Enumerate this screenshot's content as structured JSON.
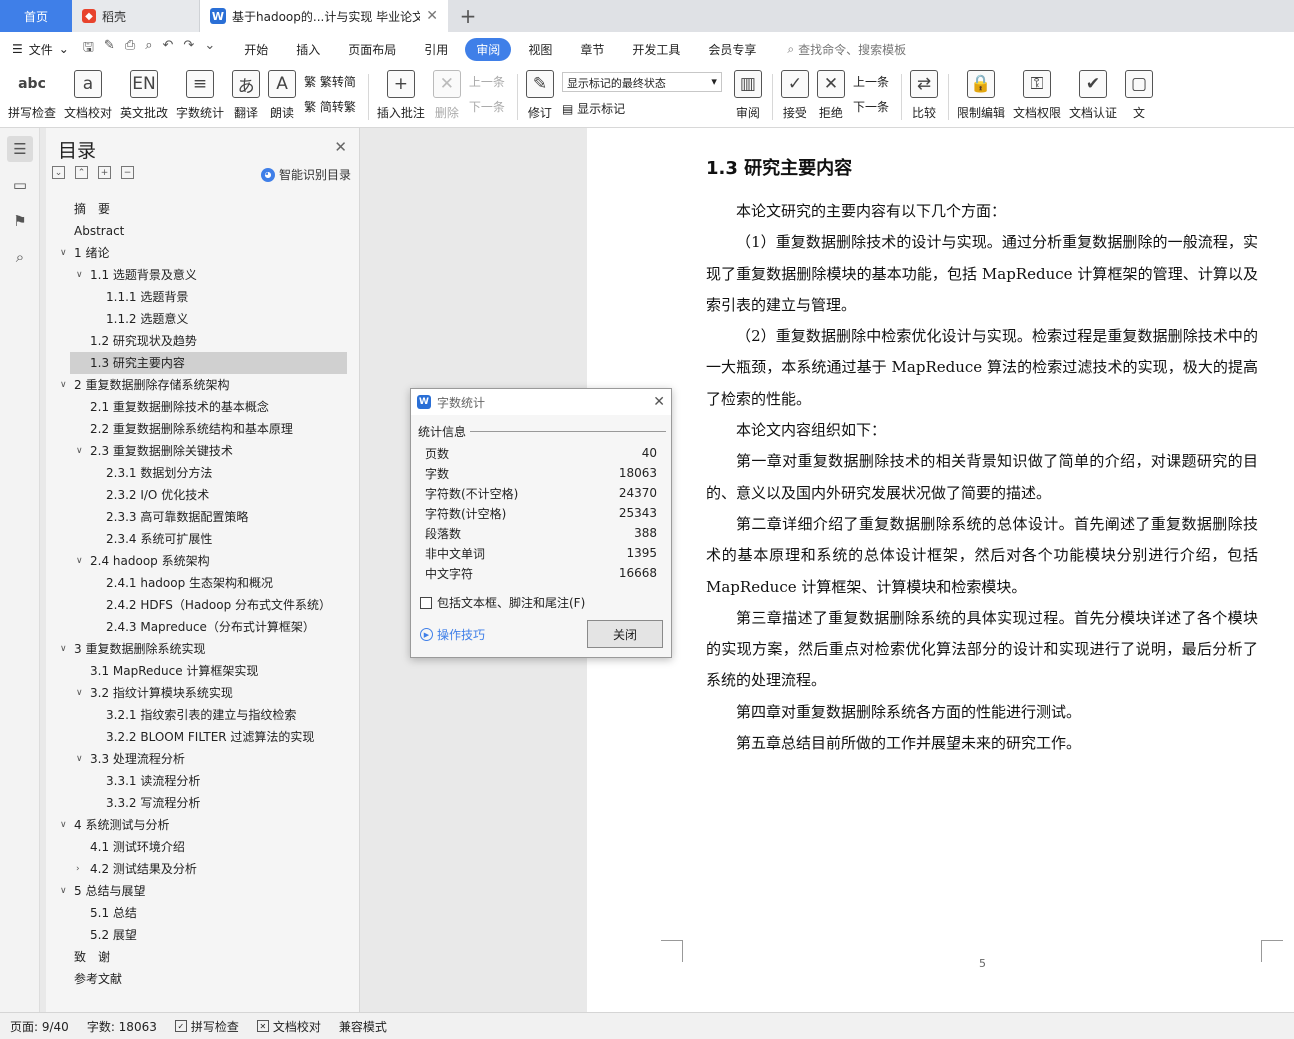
{
  "tabs": {
    "home": "首页",
    "wps": "稻壳",
    "doc": "基于hadoop的...计与实现 毕业论文",
    "add": "+"
  },
  "menubar": {
    "file": "文件",
    "tabs": [
      "开始",
      "插入",
      "页面布局",
      "引用",
      "审阅",
      "视图",
      "章节",
      "开发工具",
      "会员专享"
    ],
    "active_tab": "审阅",
    "search": "查找命令、搜索模板"
  },
  "ribbon": {
    "spellcheck": "拼写检查",
    "doccheck": "文档校对",
    "en_correct": "英文批改",
    "wordcount": "字数统计",
    "translate": "翻译",
    "read": "朗读",
    "simp_to_trad": "繁转简",
    "trad_to_simp": "简转繁",
    "insert_comment": "插入批注",
    "delete": "删除",
    "prev": "上一条",
    "next": "下一条",
    "revise": "修订",
    "markup_state": "显示标记的最终状态",
    "show_markup": "显示标记",
    "review": "审阅",
    "accept": "接受",
    "reject": "拒绝",
    "prev2": "上一条",
    "next2": "下一条",
    "compare": "比较",
    "restrict": "限制编辑",
    "permission": "文档权限",
    "certify": "文档认证",
    "more": "文"
  },
  "toc": {
    "title": "目录",
    "smart": "智能识别目录",
    "items": [
      {
        "text": "摘　要",
        "level": 0,
        "arrow": ""
      },
      {
        "text": "Abstract",
        "level": 0,
        "arrow": ""
      },
      {
        "text": "1  绪论",
        "level": 0,
        "arrow": "down"
      },
      {
        "text": "1.1 选题背景及意义",
        "level": 1,
        "arrow": "down"
      },
      {
        "text": "1.1.1 选题背景",
        "level": 2,
        "arrow": ""
      },
      {
        "text": "1.1.2 选题意义",
        "level": 2,
        "arrow": ""
      },
      {
        "text": "1.2 研究现状及趋势",
        "level": 1,
        "arrow": ""
      },
      {
        "text": "1.3 研究主要内容",
        "level": 1,
        "arrow": "",
        "selected": true
      },
      {
        "text": "2  重复数据删除存储系统架构",
        "level": 0,
        "arrow": "down"
      },
      {
        "text": "2.1  重复数据删除技术的基本概念",
        "level": 1,
        "arrow": ""
      },
      {
        "text": "2.2  重复数据删除系统结构和基本原理",
        "level": 1,
        "arrow": ""
      },
      {
        "text": "2.3  重复数据删除关键技术",
        "level": 1,
        "arrow": "down"
      },
      {
        "text": "2.3.1  数据划分方法",
        "level": 2,
        "arrow": ""
      },
      {
        "text": "2.3.2 I/O 优化技术",
        "level": 2,
        "arrow": ""
      },
      {
        "text": "2.3.3  高可靠数据配置策略",
        "level": 2,
        "arrow": ""
      },
      {
        "text": "2.3.4  系统可扩展性",
        "level": 2,
        "arrow": ""
      },
      {
        "text": "2.4 hadoop 系统架构",
        "level": 1,
        "arrow": "down"
      },
      {
        "text": "2.4.1 hadoop 生态架构和概况",
        "level": 2,
        "arrow": ""
      },
      {
        "text": "2.4.2 HDFS（Hadoop 分布式文件系统）",
        "level": 2,
        "arrow": ""
      },
      {
        "text": "2.4.3 Mapreduce（分布式计算框架）",
        "level": 2,
        "arrow": ""
      },
      {
        "text": "3  重复数据删除系统实现",
        "level": 0,
        "arrow": "down"
      },
      {
        "text": "3.1 MapReduce 计算框架实现",
        "level": 1,
        "arrow": ""
      },
      {
        "text": "3.2 指纹计算模块系统实现",
        "level": 1,
        "arrow": "down"
      },
      {
        "text": "3.2.1  指纹索引表的建立与指纹检索",
        "level": 2,
        "arrow": ""
      },
      {
        "text": "3.2.2 BLOOM FILTER 过滤算法的实现",
        "level": 2,
        "arrow": ""
      },
      {
        "text": "3.3 处理流程分析",
        "level": 1,
        "arrow": "down"
      },
      {
        "text": "3.3.1 读流程分析",
        "level": 2,
        "arrow": ""
      },
      {
        "text": "3.3.2  写流程分析",
        "level": 2,
        "arrow": ""
      },
      {
        "text": "4 系统测试与分析",
        "level": 0,
        "arrow": "down"
      },
      {
        "text": "4.1  测试环境介绍",
        "level": 1,
        "arrow": ""
      },
      {
        "text": "4.2  测试结果及分析",
        "level": 1,
        "arrow": "right"
      },
      {
        "text": "5  总结与展望",
        "level": 0,
        "arrow": "down"
      },
      {
        "text": "5.1  总结",
        "level": 1,
        "arrow": ""
      },
      {
        "text": "5.2  展望",
        "level": 1,
        "arrow": ""
      },
      {
        "text": "致　谢",
        "level": 0,
        "arrow": ""
      },
      {
        "text": "参考文献",
        "level": 0,
        "arrow": ""
      }
    ]
  },
  "document": {
    "heading": "1.3 研究主要内容",
    "paragraphs": [
      "本论文研究的主要内容有以下几个方面：",
      "（1）重复数据删除技术的设计与实现。通过分析重复数据删除的一般流程，实现了重复数据删除模块的基本功能，包括 MapReduce 计算框架的管理、计算以及索引表的建立与管理。",
      "（2）重复数据删除中检索优化设计与实现。检索过程是重复数据删除技术中的一大瓶颈，本系统通过基于 MapReduce 算法的检索过滤技术的实现，极大的提高了检索的性能。",
      "本论文内容组织如下：",
      "第一章对重复数据删除技术的相关背景知识做了简单的介绍，对课题研究的目的、意义以及国内外研究发展状况做了简要的描述。",
      "第二章详细介绍了重复数据删除系统的总体设计。首先阐述了重复数据删除技术的基本原理和系统的总体设计框架，然后对各个功能模块分别进行介绍，包括 MapReduce 计算框架、计算模块和检索模块。",
      "第三章描述了重复数据删除系统的具体实现过程。首先分模块详述了各个模块的实现方案，然后重点对检索优化算法部分的设计和实现进行了说明，最后分析了系统的处理流程。",
      "第四章对重复数据删除系统各方面的性能进行测试。",
      "第五章总结目前所做的工作并展望未来的研究工作。"
    ],
    "page_number": "5"
  },
  "dialog": {
    "title": "字数统计",
    "section": "统计信息",
    "rows": [
      {
        "label": "页数",
        "value": "40"
      },
      {
        "label": "字数",
        "value": "18063"
      },
      {
        "label": "字符数(不计空格)",
        "value": "24370"
      },
      {
        "label": "字符数(计空格)",
        "value": "25343"
      },
      {
        "label": "段落数",
        "value": "388"
      },
      {
        "label": "非中文单词",
        "value": "1395"
      },
      {
        "label": "中文字符",
        "value": "16668"
      }
    ],
    "checkbox": "包括文本框、脚注和尾注(F)",
    "tips": "操作技巧",
    "close": "关闭"
  },
  "statusbar": {
    "page": "页面: 9/40",
    "words": "字数: 18063",
    "spell": "拼写检查",
    "doccheck": "文档校对",
    "compat": "兼容模式"
  }
}
